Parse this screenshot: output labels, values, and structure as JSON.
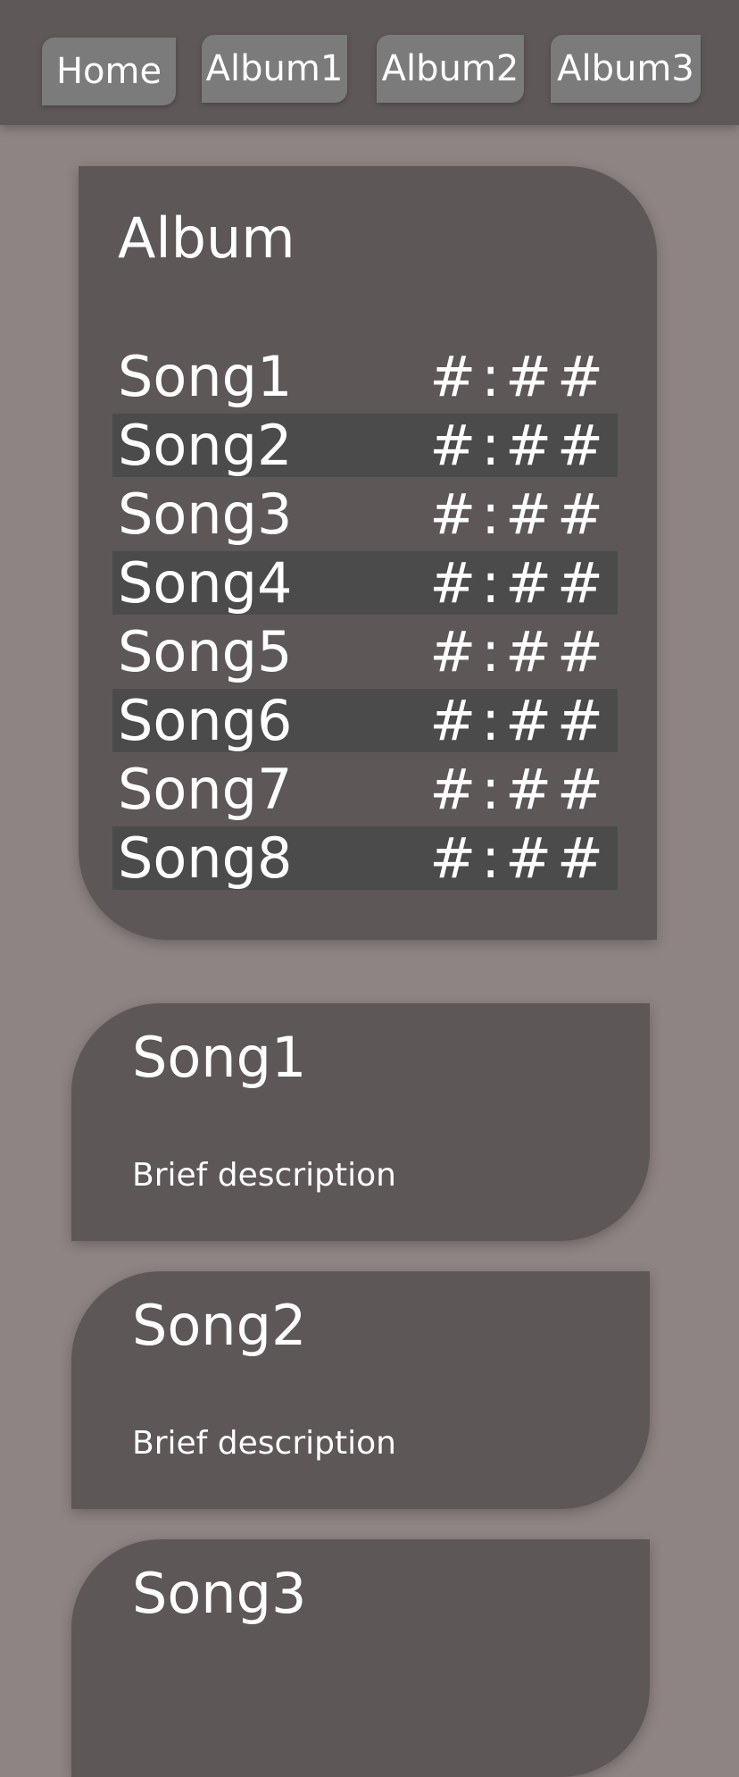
{
  "nav": {
    "home": "Home",
    "album1": "Album1",
    "album2": "Album2",
    "album3": "Album3"
  },
  "album": {
    "title": "Album",
    "songs": [
      {
        "name": "Song1",
        "duration": "#:##"
      },
      {
        "name": "Song2",
        "duration": "#:##"
      },
      {
        "name": "Song3",
        "duration": "#:##"
      },
      {
        "name": "Song4",
        "duration": "#:##"
      },
      {
        "name": "Song5",
        "duration": "#:##"
      },
      {
        "name": "Song6",
        "duration": "#:##"
      },
      {
        "name": "Song7",
        "duration": "#:##"
      },
      {
        "name": "Song8",
        "duration": "#:##"
      }
    ]
  },
  "cards": [
    {
      "title": "Song1",
      "description": "Brief description"
    },
    {
      "title": "Song2",
      "description": "Brief description"
    },
    {
      "title": "Song3",
      "description": ""
    }
  ],
  "colors": {
    "background": "#8f8484",
    "topbar": "#5f5858",
    "card": "#5e5757",
    "nav_button": "#7b7b7b",
    "row_alt": "#4b4b4b",
    "text": "#ffffff"
  }
}
